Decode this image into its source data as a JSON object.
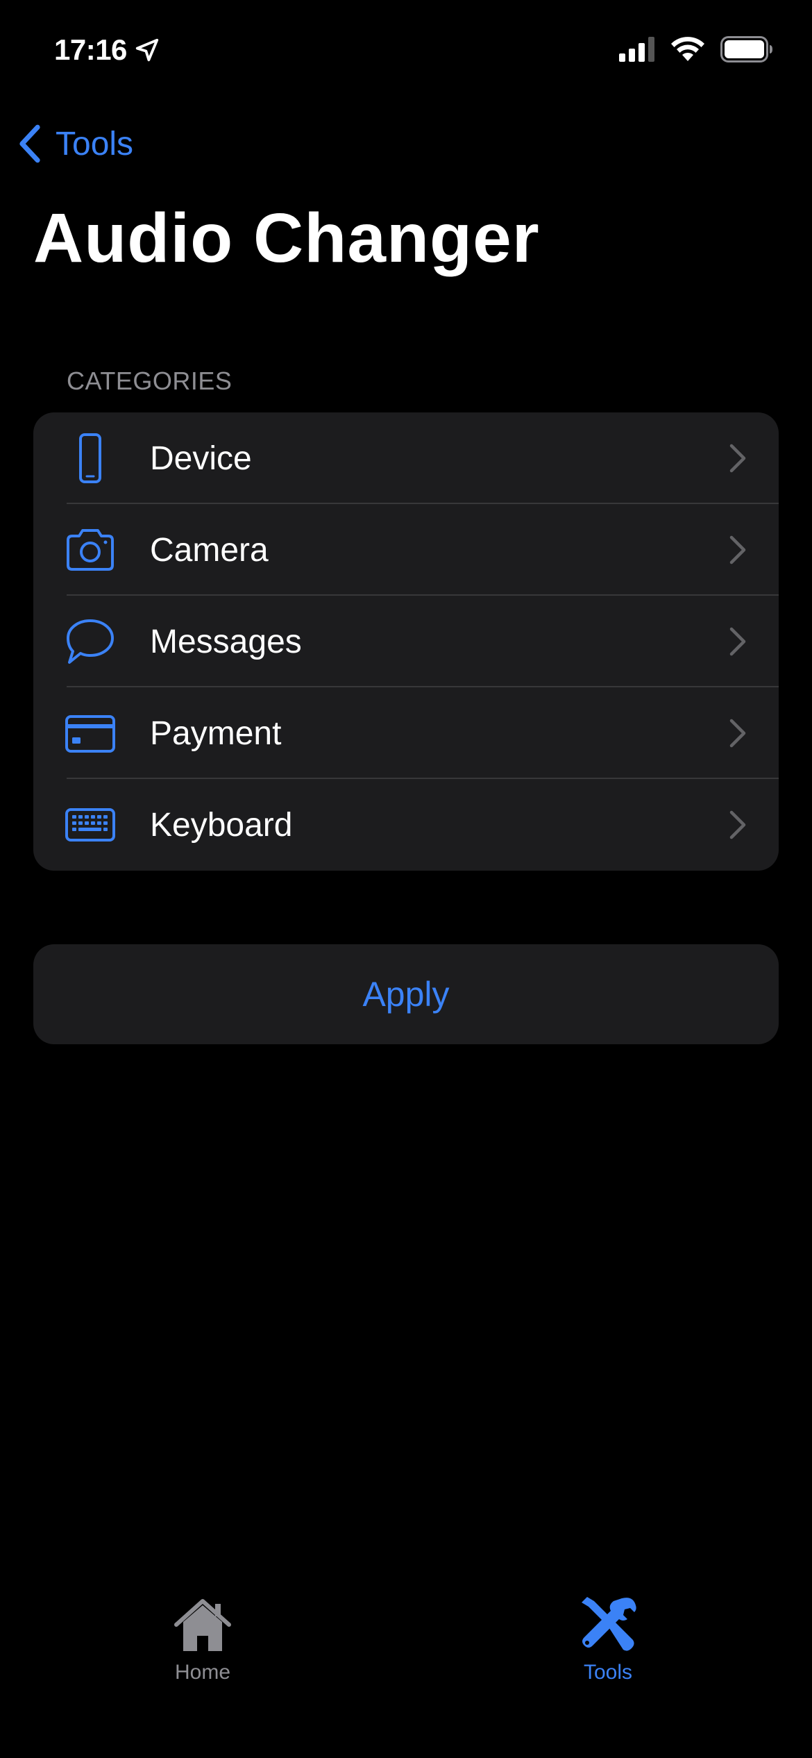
{
  "status_bar": {
    "time": "17:16"
  },
  "nav": {
    "back_label": "Tools"
  },
  "page": {
    "title": "Audio Changer"
  },
  "categories": {
    "header": "CATEGORIES",
    "items": [
      {
        "label": "Device",
        "icon": "phone-icon"
      },
      {
        "label": "Camera",
        "icon": "camera-icon"
      },
      {
        "label": "Messages",
        "icon": "message-bubble-icon"
      },
      {
        "label": "Payment",
        "icon": "credit-card-icon"
      },
      {
        "label": "Keyboard",
        "icon": "keyboard-icon"
      }
    ]
  },
  "apply": {
    "label": "Apply"
  },
  "tab_bar": {
    "tabs": [
      {
        "label": "Home",
        "icon": "house-icon",
        "active": false
      },
      {
        "label": "Tools",
        "icon": "tools-icon",
        "active": true
      }
    ]
  },
  "colors": {
    "accent": "#3b82f6",
    "background": "#000000",
    "card": "#1c1c1e",
    "secondary_text": "#8e8e93"
  }
}
